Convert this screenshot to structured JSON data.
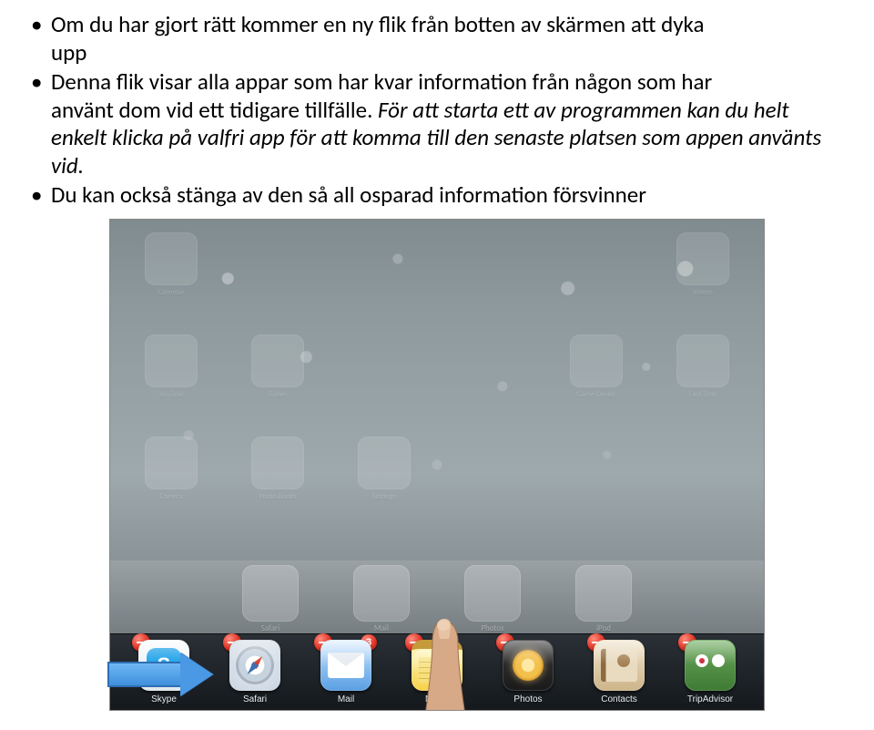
{
  "bullets": {
    "b1_a": "Om du har gjort rätt kommer en ny flik från botten av skärmen att dyka",
    "b1_b": "upp",
    "b2_a": "Denna flik visar alla appar som har kvar information från någon som har",
    "b2_b": "använt dom vid ett tidigare tillfälle. ",
    "b2_c": "För att starta ett av programmen kan du helt enkelt klicka på valfri app för att komma till den senaste platsen som appen använts vid.",
    "b3": "Du kan också stänga av den så all osparad information försvinner"
  },
  "bg": {
    "r1": [
      "Calendar",
      "",
      "",
      "",
      "",
      "Videos"
    ],
    "r2": [
      "YouTube",
      "iTunes",
      "",
      "",
      "Game Center",
      "FaceTime"
    ],
    "r3": [
      "Camera",
      "Photo Booth",
      "Settings",
      "",
      "",
      ""
    ]
  },
  "dock": {
    "items": [
      "Safari",
      "Mail",
      "Photos",
      "iPod"
    ]
  },
  "mtbar": {
    "apps": [
      {
        "label": "Skype",
        "badge": null
      },
      {
        "label": "Safari",
        "badge": null
      },
      {
        "label": "Mail",
        "badge": "3"
      },
      {
        "label": "Notes",
        "badge": null
      },
      {
        "label": "Photos",
        "badge": null
      },
      {
        "label": "Contacts",
        "badge": null
      },
      {
        "label": "TripAdvisor",
        "badge": null
      }
    ]
  }
}
